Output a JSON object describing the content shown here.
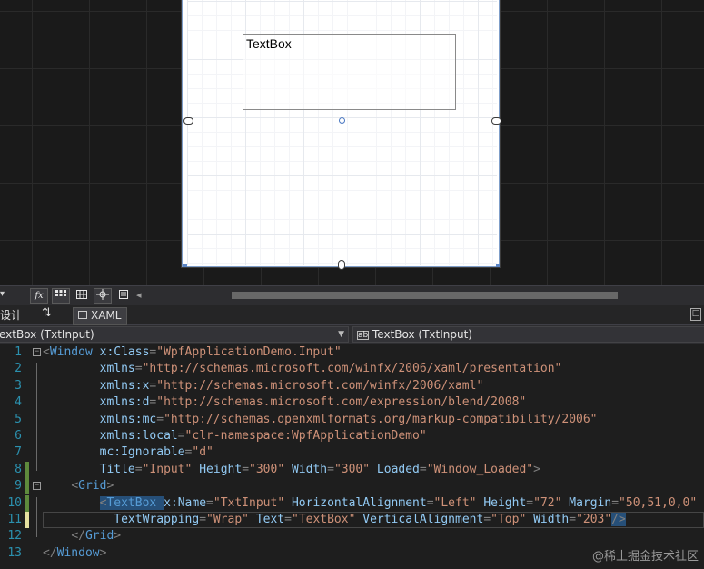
{
  "designer": {
    "textbox_text": "TextBox"
  },
  "toolbar": {
    "zoom_arrow": "▾",
    "fx_label": "fx",
    "buttons": [
      "fx-button",
      "grid-button",
      "snap-grid-button",
      "artboard-button",
      "effects-button"
    ],
    "scroll_left_glyph": "◂"
  },
  "tabs": {
    "design_label": "设计",
    "swap_glyph": "⇅",
    "xaml_label": "XAML",
    "split_glyph": "□"
  },
  "selectors": {
    "left": "extBox (TxtInput)",
    "right": "TextBox (TxtInput)"
  },
  "code_lines": [
    {
      "n": "1",
      "tokens": [
        [
          "punct",
          "<"
        ],
        [
          "elem",
          "Window "
        ],
        [
          "attr",
          "x:Class"
        ],
        [
          "punct",
          "="
        ],
        [
          "val",
          "\"WpfApplicationDemo.Input\""
        ]
      ]
    },
    {
      "n": "2",
      "tokens": [
        [
          "text",
          "        "
        ],
        [
          "attr",
          "xmlns"
        ],
        [
          "punct",
          "="
        ],
        [
          "val",
          "\"http://schemas.microsoft.com/winfx/2006/xaml/presentation\""
        ]
      ]
    },
    {
      "n": "3",
      "tokens": [
        [
          "text",
          "        "
        ],
        [
          "attr",
          "xmlns:x"
        ],
        [
          "punct",
          "="
        ],
        [
          "val",
          "\"http://schemas.microsoft.com/winfx/2006/xaml\""
        ]
      ]
    },
    {
      "n": "4",
      "tokens": [
        [
          "text",
          "        "
        ],
        [
          "attr",
          "xmlns:d"
        ],
        [
          "punct",
          "="
        ],
        [
          "val",
          "\"http://schemas.microsoft.com/expression/blend/2008\""
        ]
      ]
    },
    {
      "n": "5",
      "tokens": [
        [
          "text",
          "        "
        ],
        [
          "attr",
          "xmlns:mc"
        ],
        [
          "punct",
          "="
        ],
        [
          "val",
          "\"http://schemas.openxmlformats.org/markup-compatibility/2006\""
        ]
      ]
    },
    {
      "n": "6",
      "tokens": [
        [
          "text",
          "        "
        ],
        [
          "attr",
          "xmlns:local"
        ],
        [
          "punct",
          "="
        ],
        [
          "val",
          "\"clr-namespace:WpfApplicationDemo\""
        ]
      ]
    },
    {
      "n": "7",
      "tokens": [
        [
          "text",
          "        "
        ],
        [
          "attr",
          "mc:Ignorable"
        ],
        [
          "punct",
          "="
        ],
        [
          "val",
          "\"d\""
        ]
      ]
    },
    {
      "n": "8",
      "tokens": [
        [
          "text",
          "        "
        ],
        [
          "attr",
          "Title"
        ],
        [
          "punct",
          "="
        ],
        [
          "val",
          "\"Input\" "
        ],
        [
          "attr",
          "Height"
        ],
        [
          "punct",
          "="
        ],
        [
          "val",
          "\"300\" "
        ],
        [
          "attr",
          "Width"
        ],
        [
          "punct",
          "="
        ],
        [
          "val",
          "\"300\" "
        ],
        [
          "attr",
          "Loaded"
        ],
        [
          "punct",
          "="
        ],
        [
          "val",
          "\"Window_Loaded\""
        ],
        [
          "punct",
          ">"
        ]
      ]
    },
    {
      "n": "9",
      "tokens": [
        [
          "text",
          "    "
        ],
        [
          "punct",
          "<"
        ],
        [
          "elem",
          "Grid"
        ],
        [
          "punct",
          ">"
        ]
      ]
    },
    {
      "n": "10",
      "tokens": [
        [
          "text",
          "        "
        ],
        [
          "punct",
          "<"
        ],
        [
          "elem",
          "TextBox "
        ],
        [
          "attr",
          "x:Name"
        ],
        [
          "punct",
          "="
        ],
        [
          "val",
          "\"TxtInput\" "
        ],
        [
          "attr",
          "HorizontalAlignment"
        ],
        [
          "punct",
          "="
        ],
        [
          "val",
          "\"Left\" "
        ],
        [
          "attr",
          "Height"
        ],
        [
          "punct",
          "="
        ],
        [
          "val",
          "\"72\" "
        ],
        [
          "attr",
          "Margin"
        ],
        [
          "punct",
          "="
        ],
        [
          "val",
          "\"50,51,0,0\""
        ]
      ]
    },
    {
      "n": "11",
      "tokens": [
        [
          "text",
          "          "
        ],
        [
          "attr",
          "TextWrapping"
        ],
        [
          "punct",
          "="
        ],
        [
          "val",
          "\"Wrap\" "
        ],
        [
          "attr",
          "Text"
        ],
        [
          "punct",
          "="
        ],
        [
          "val",
          "\"TextBox\" "
        ],
        [
          "attr",
          "VerticalAlignment"
        ],
        [
          "punct",
          "="
        ],
        [
          "val",
          "\"Top\" "
        ],
        [
          "attr",
          "Width"
        ],
        [
          "punct",
          "="
        ],
        [
          "val",
          "\"203\""
        ],
        [
          "punct",
          "/>"
        ]
      ]
    },
    {
      "n": "12",
      "tokens": [
        [
          "text",
          "    "
        ],
        [
          "punct",
          "</"
        ],
        [
          "elem",
          "Grid"
        ],
        [
          "punct",
          ">"
        ]
      ]
    },
    {
      "n": "13",
      "tokens": [
        [
          "punct",
          "</"
        ],
        [
          "elem",
          "Window"
        ],
        [
          "punct",
          ">"
        ]
      ]
    }
  ],
  "watermark": "@稀土掘金技术社区"
}
